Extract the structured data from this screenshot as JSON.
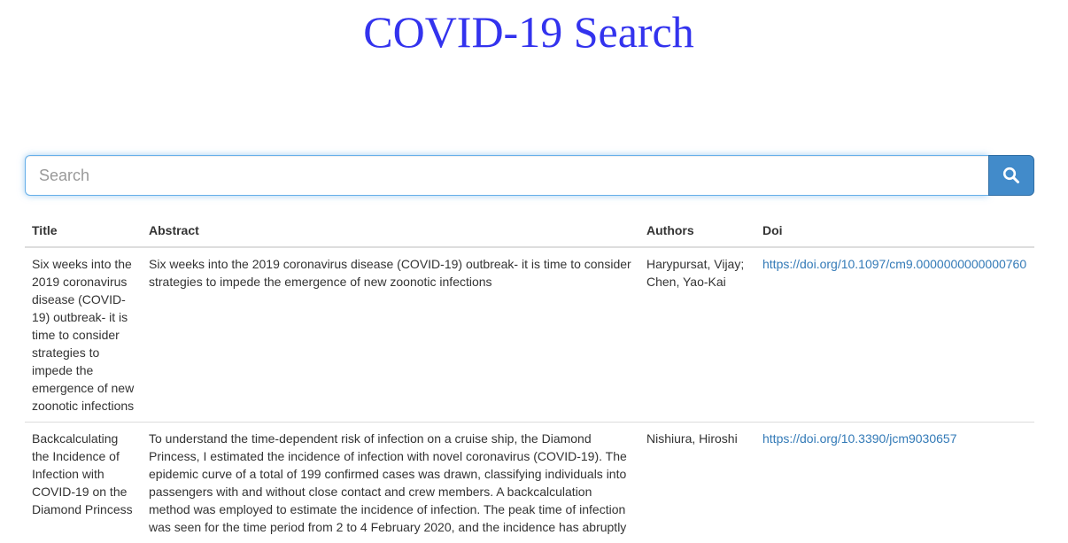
{
  "header": {
    "title": "COVID-19 Search"
  },
  "search": {
    "placeholder": "Search",
    "value": "",
    "button_icon": "search-icon"
  },
  "colors": {
    "title": "#3333ee",
    "accent": "#428bca",
    "link": "#337ab7",
    "focus_border": "#66afe9"
  },
  "table": {
    "columns": [
      "Title",
      "Abstract",
      "Authors",
      "Doi"
    ],
    "rows": [
      {
        "title": "Six weeks into the 2019 coronavirus disease (COVID-19) outbreak- it is time to consider strategies to impede the emergence of new zoonotic infections",
        "abstract": "Six weeks into the 2019 coronavirus disease (COVID-19) outbreak- it is time to consider strategies to impede the emergence of new zoonotic infections",
        "authors": "Harypursat, Vijay; Chen, Yao-Kai",
        "doi": "https://doi.org/10.1097/cm9.0000000000000760"
      },
      {
        "title": "Backcalculating the Incidence of Infection with COVID-19 on the Diamond Princess",
        "abstract": "To understand the time-dependent risk of infection on a cruise ship, the Diamond Princess, I estimated the incidence of infection with novel coronavirus (COVID-19). The epidemic curve of a total of 199 confirmed cases was drawn, classifying individuals into passengers with and without close contact and crew members. A backcalculation method was employed to estimate the incidence of infection. The peak time of infection was seen for the time period from 2 to 4 February 2020, and the incidence has abruptly",
        "authors": "Nishiura, Hiroshi",
        "doi": "https://doi.org/10.3390/jcm9030657"
      }
    ]
  }
}
